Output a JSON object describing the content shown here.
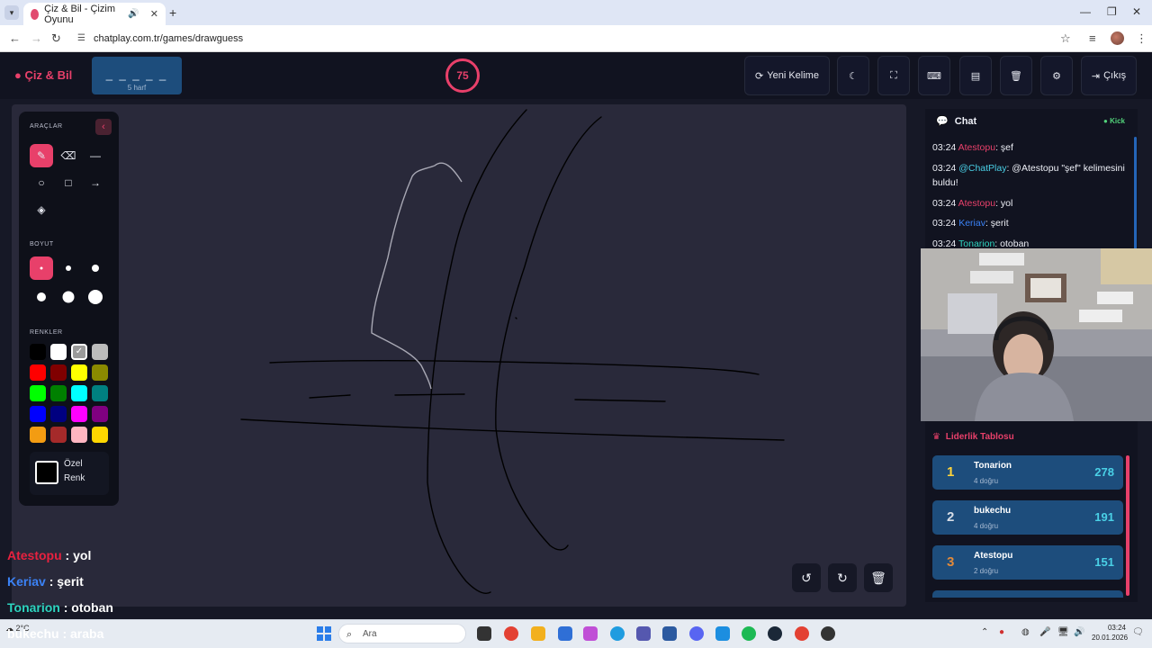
{
  "browser": {
    "tab_title": "Çiz & Bil - Çizim Oyunu",
    "url": "chatplay.com.tr/games/drawguess"
  },
  "header": {
    "logo": "Çiz & Bil",
    "word_mask": "_ _ _ _ _",
    "word_length": "5 harf",
    "timer": "75",
    "new_word": "Yeni Kelime",
    "exit": "Çıkış"
  },
  "tools": {
    "title": "ARAÇLAR",
    "size_title": "BOYUT",
    "colors_title": "RENKLER",
    "custom_line1": "Özel",
    "custom_line2": "Renk",
    "palette": [
      "#000000",
      "#ffffff",
      "#9a9a9a",
      "#bcbcbc",
      "#ff0000",
      "#800000",
      "#ffff00",
      "#8a8a00",
      "#00ff00",
      "#008000",
      "#00ffff",
      "#008080",
      "#0000ff",
      "#000080",
      "#ff00ff",
      "#800080",
      "#f39c12",
      "#a52a2a",
      "#ffb6c1",
      "#ffd700"
    ]
  },
  "chat": {
    "title": "Chat",
    "platform": "Kick",
    "messages": [
      {
        "time": "03:24",
        "user": "Atestopu",
        "color": "#e8406a",
        "text": ": şef"
      },
      {
        "time": "03:24",
        "user": "@ChatPlay",
        "color": "#4ad0e6",
        "text": ": @Atestopu \"şef\" kelimesini buldu!"
      },
      {
        "time": "03:24",
        "user": "Atestopu",
        "color": "#e8406a",
        "text": ": yol"
      },
      {
        "time": "03:24",
        "user": "Keriav",
        "color": "#3b82f6",
        "text": ": şerit"
      },
      {
        "time": "03:24",
        "user": "Tonarion",
        "color": "#2dd4bf",
        "text": ": otoban"
      }
    ]
  },
  "overlay": [
    {
      "user": "Atestopu",
      "color": "#e8213f",
      "text": " : yol"
    },
    {
      "user": "Keriav",
      "color": "#3b82f6",
      "text": " : şerit"
    },
    {
      "user": "Tonarion",
      "color": "#2dd4bf",
      "text": " : otoban"
    },
    {
      "user": "bukechu",
      "color": "#ffffff",
      "text": " : araba"
    }
  ],
  "leaderboard": {
    "title": "Liderlik Tablosu",
    "rows": [
      {
        "rank": "1",
        "rank_color": "#ffd43b",
        "name": "Tonarion",
        "correct": "4 doğru",
        "points": "278"
      },
      {
        "rank": "2",
        "rank_color": "#d7dde6",
        "name": "bukechu",
        "correct": "4 doğru",
        "points": "191"
      },
      {
        "rank": "3",
        "rank_color": "#e28a3a",
        "name": "Atestopu",
        "correct": "2 doğru",
        "points": "151"
      }
    ]
  },
  "taskbar": {
    "weather": "2°C",
    "search": "Ara",
    "time": "03:24",
    "date": "20.01.2026"
  }
}
